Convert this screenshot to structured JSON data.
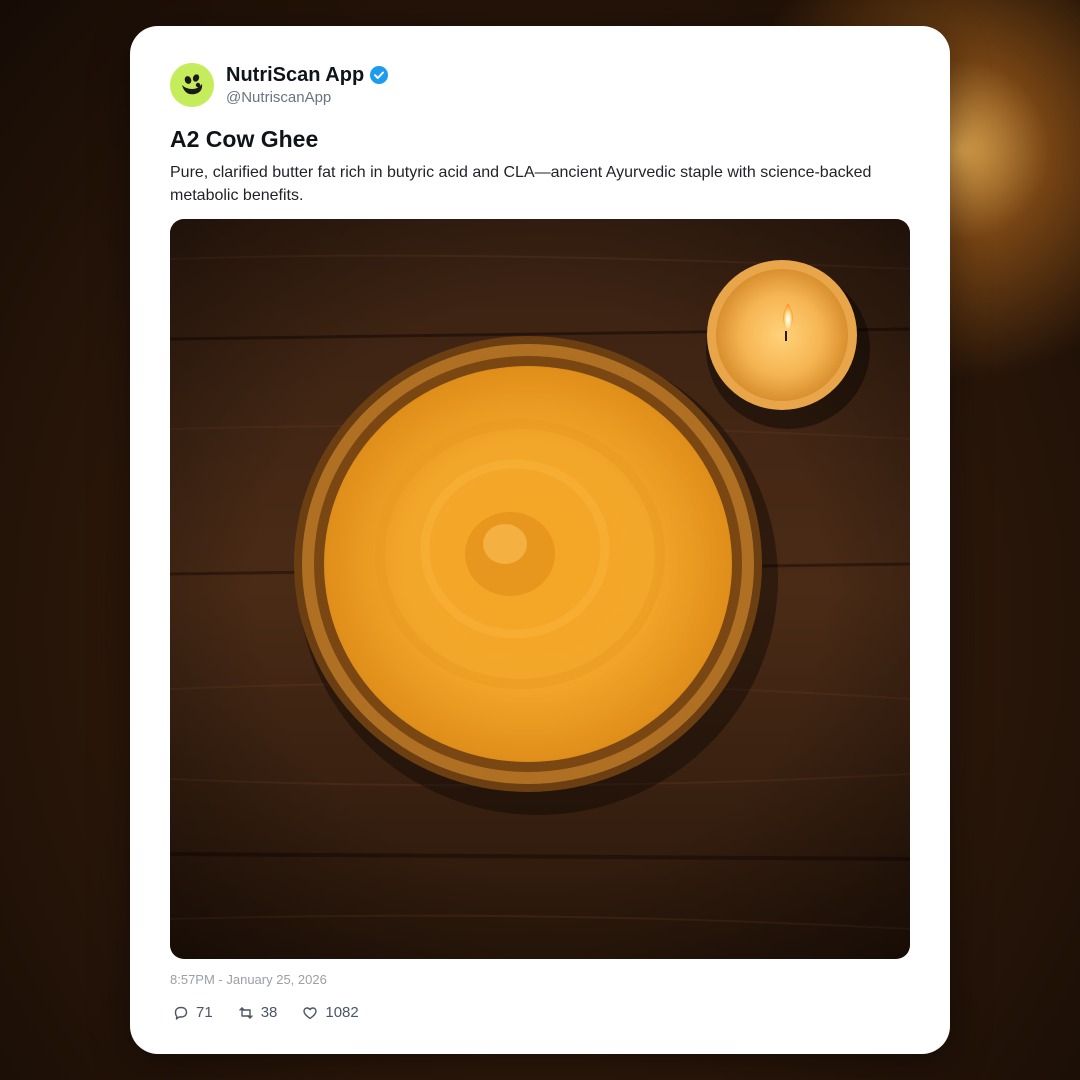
{
  "post": {
    "display_name": "NutriScan App",
    "handle": "@NutriscanApp",
    "verified": true,
    "avatar_icon": "nutriscan-logo-icon",
    "title": "A2 Cow Ghee",
    "description": "Pure, clarified butter fat rich in butyric acid and CLA—ancient Ayurvedic staple with science-backed metabolic benefits.",
    "image_subject": "bowl-of-ghee-with-candle-photo",
    "timestamp": "8:57PM - January 25, 2026",
    "stats": {
      "replies": "71",
      "retweets": "38",
      "likes": "1082"
    }
  },
  "colors": {
    "avatar_bg": "#c5ec5a",
    "verified_blue": "#1d9bf0",
    "card_bg": "#ffffff"
  }
}
